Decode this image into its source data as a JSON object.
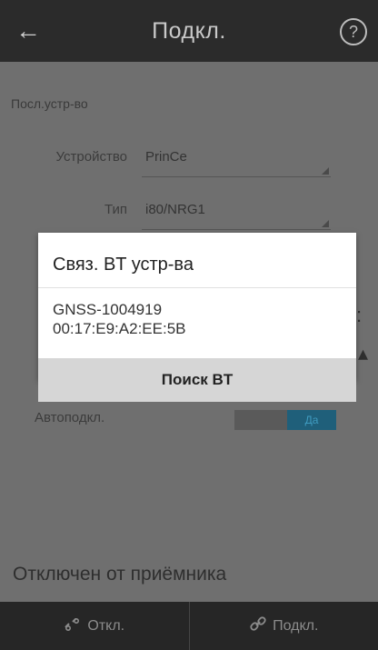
{
  "header": {
    "title": "Подкл.",
    "back_icon": "←",
    "help_icon": "?"
  },
  "page": {
    "section_label": "Посл.устр-во",
    "device_label": "Устройство",
    "device_value": "PrinCe",
    "type_label": "Тип",
    "type_value": "i80/NRG1",
    "autoconnect_label": "Автоподкл.",
    "autoconnect_state": "Да",
    "status": "Отключен от приёмника"
  },
  "dialog": {
    "title": "Связ. BT устр-ва",
    "devices": [
      {
        "name": "GNSS-1004919",
        "mac": "00:17:E9:A2:EE:5B"
      }
    ],
    "search_button": "Поиск BT"
  },
  "bottom_bar": {
    "disconnect_label": "Откл.",
    "connect_label": "Подкл.",
    "disconnect_icon": "unlink-icon",
    "connect_icon": "link-icon"
  },
  "colors": {
    "header_bg": "#2b2b2b",
    "overlay_bg": "#6f6f6f",
    "dialog_bg": "#ffffff",
    "button_bg": "#d6d6d6",
    "toggle_on": "#1f5f7a"
  }
}
